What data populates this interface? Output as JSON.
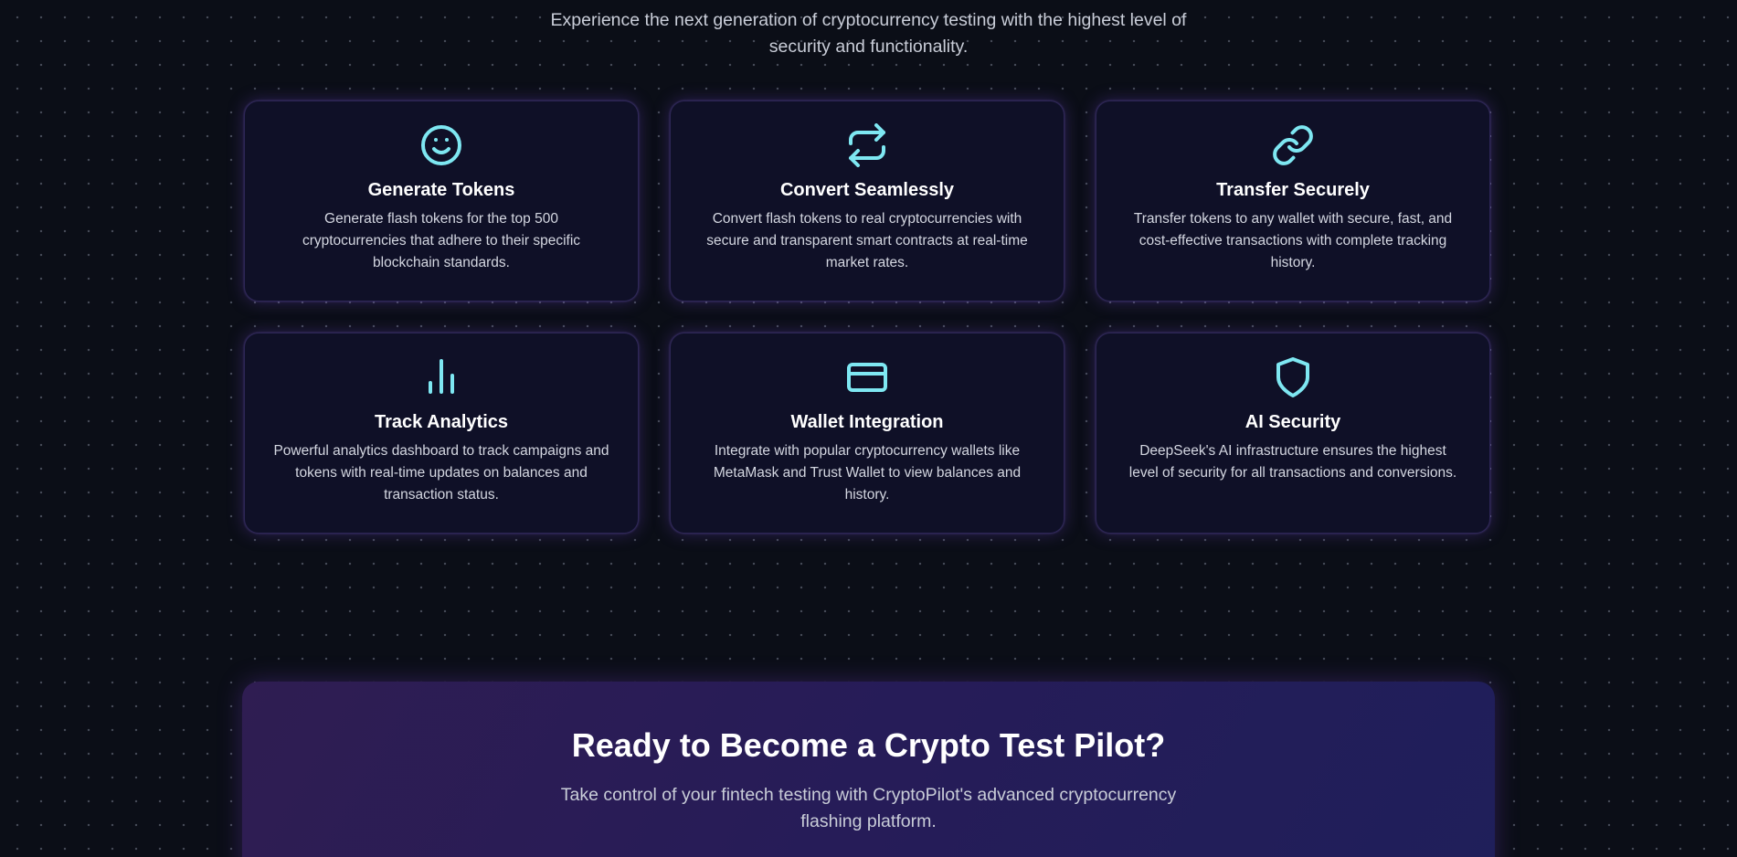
{
  "intro": {
    "line1": "Experience the next generation of cryptocurrency testing with the highest level of",
    "line2": "security and functionality."
  },
  "colors": {
    "accent_icon": "#7ee7f2",
    "card_background": "#0f1027",
    "page_background": "#0b0e17"
  },
  "features": [
    {
      "icon": "smiley-face-icon",
      "title": "Generate Tokens",
      "description": "Generate flash tokens for the top 500 cryptocurrencies that adhere to their specific blockchain standards."
    },
    {
      "icon": "repeat-arrows-icon",
      "title": "Convert Seamlessly",
      "description": "Convert flash tokens to real cryptocurrencies with secure and transparent smart contracts at real-time market rates."
    },
    {
      "icon": "link-icon",
      "title": "Transfer Securely",
      "description": "Transfer tokens to any wallet with secure, fast, and cost-effective transactions with complete tracking history."
    },
    {
      "icon": "bar-chart-icon",
      "title": "Track Analytics",
      "description": "Powerful analytics dashboard to track campaigns and tokens with real-time updates on balances and transaction status."
    },
    {
      "icon": "credit-card-icon",
      "title": "Wallet Integration",
      "description": "Integrate with popular cryptocurrency wallets like MetaMask and Trust Wallet to view balances and history."
    },
    {
      "icon": "shield-icon",
      "title": "AI Security",
      "description": "DeepSeek's AI infrastructure ensures the highest level of security for all transactions and conversions."
    }
  ],
  "cta": {
    "title": "Ready to Become a Crypto Test Pilot?",
    "description": "Take control of your fintech testing with CryptoPilot's advanced cryptocurrency flashing platform."
  }
}
